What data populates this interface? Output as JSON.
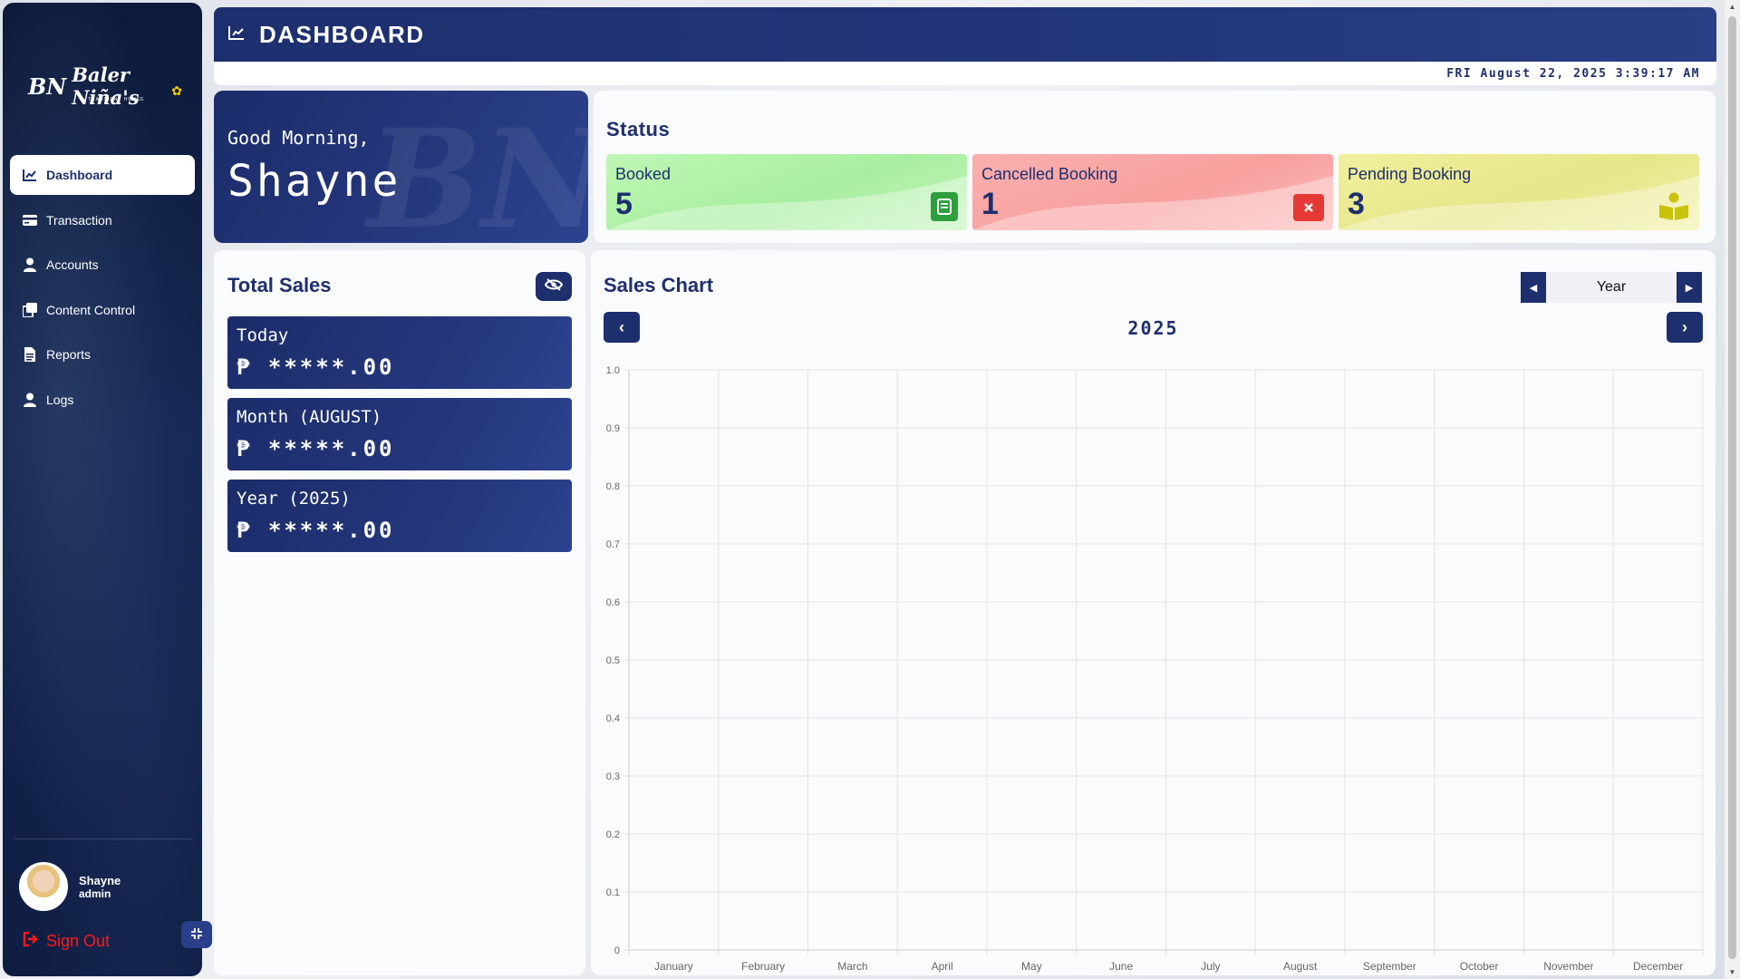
{
  "app": {
    "logo": "BN",
    "logo_text": "Baler Niña's",
    "logo_sub": "TRANSIENT HOUSE"
  },
  "sidebar": {
    "items": [
      {
        "label": "Dashboard",
        "icon": "chart-line-icon",
        "active": true
      },
      {
        "label": "Transaction",
        "icon": "card-icon"
      },
      {
        "label": "Accounts",
        "icon": "user-icon"
      },
      {
        "label": "Content Control",
        "icon": "copy-icon"
      },
      {
        "label": "Reports",
        "icon": "document-icon"
      },
      {
        "label": "Logs",
        "icon": "user-icon"
      }
    ],
    "profile": {
      "name": "Shayne",
      "role": "admin"
    },
    "signout": "Sign Out"
  },
  "header": {
    "title": "DASHBOARD",
    "datetime": "FRI August 22, 2025 3:39:17 AM"
  },
  "greeting": {
    "salutation": "Good Morning,",
    "name": "Shayne"
  },
  "status": {
    "title": "Status",
    "cards": [
      {
        "label": "Booked",
        "value": "5",
        "color": "#2e9e3e"
      },
      {
        "label": "Cancelled Booking",
        "value": "1",
        "color": "#e53935"
      },
      {
        "label": "Pending Booking",
        "value": "3",
        "color": "#c9c20a"
      }
    ]
  },
  "total_sales": {
    "title": "Total Sales",
    "cards": [
      {
        "label": "Today",
        "amount": "₱ *****.00"
      },
      {
        "label": "Month (AUGUST)",
        "amount": "₱ *****.00"
      },
      {
        "label": "Year (2025)",
        "amount": "₱ *****.00"
      }
    ]
  },
  "sales_chart": {
    "title": "Sales Chart",
    "period": "Year",
    "year": "2025"
  },
  "chart_data": {
    "type": "bar",
    "categories": [
      "January",
      "February",
      "March",
      "April",
      "May",
      "June",
      "July",
      "August",
      "September",
      "October",
      "November",
      "December"
    ],
    "values": [
      0,
      0,
      0,
      0,
      0,
      0,
      0,
      0,
      0,
      0,
      0,
      0
    ],
    "ylim": [
      0,
      1.0
    ],
    "yticks": [
      "0",
      "0.1",
      "0.2",
      "0.3",
      "0.4",
      "0.5",
      "0.6",
      "0.7",
      "0.8",
      "0.9",
      "1.0"
    ],
    "grid": true
  },
  "colors": {
    "primary": "#1e2f6e",
    "booked": "#bff7b5",
    "cancelled": "#fbb0ae",
    "pending": "#f1ef9c"
  }
}
